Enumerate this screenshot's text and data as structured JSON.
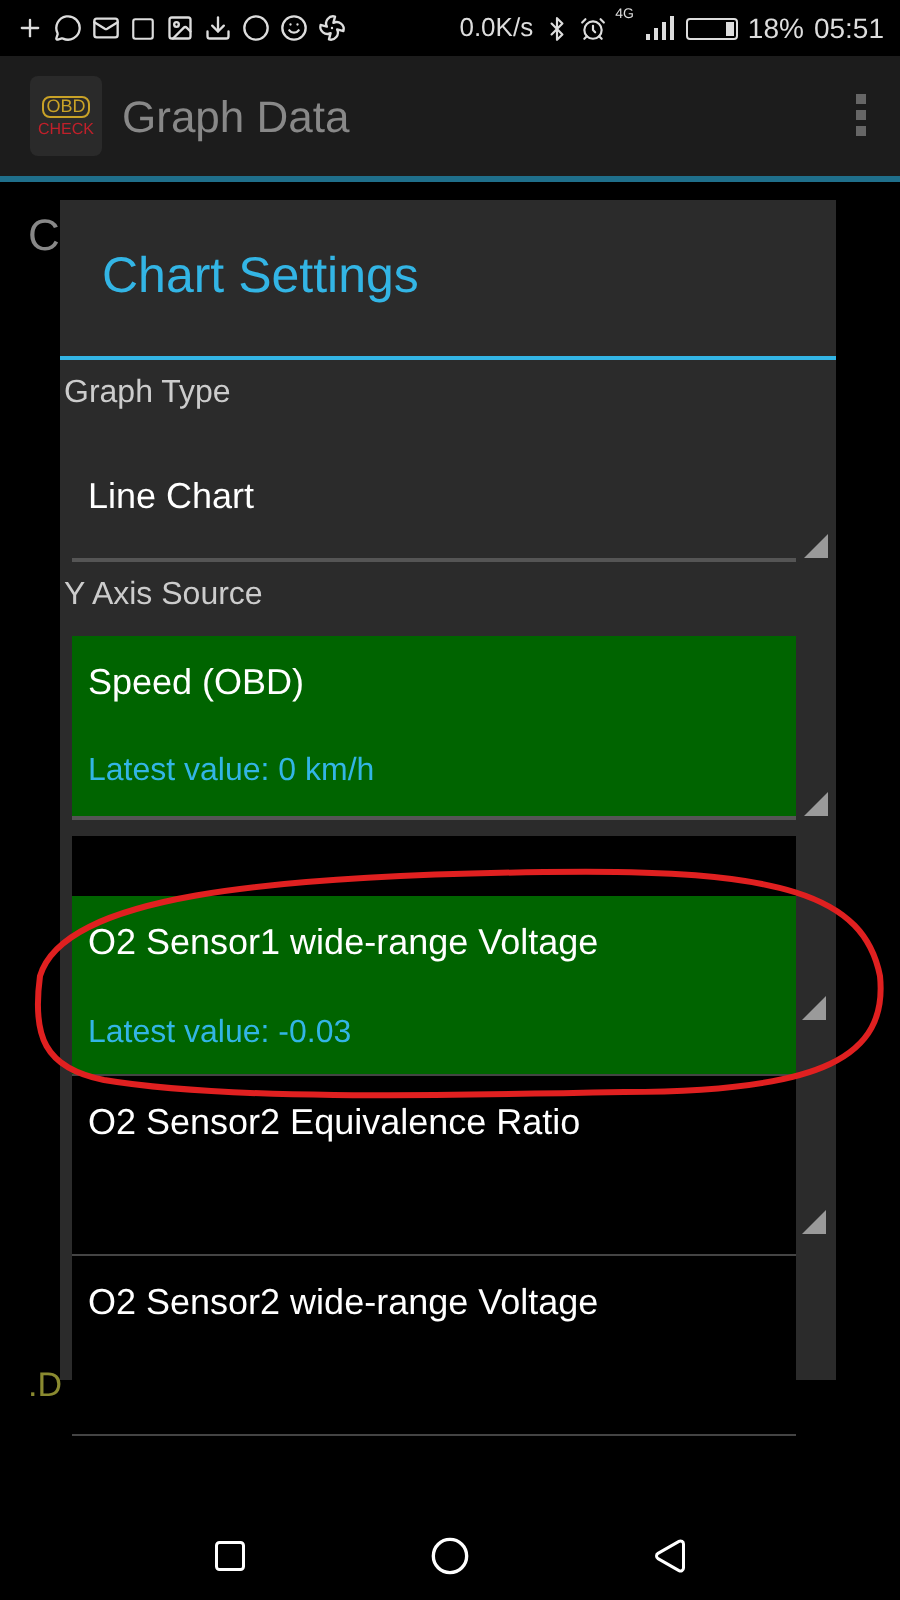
{
  "status_bar": {
    "speed": "0.0K/s",
    "network": "4G",
    "battery": "18%",
    "time": "05:51"
  },
  "app_bar": {
    "logo_top": "OBD",
    "logo_bottom": "CHECK",
    "title": "Graph Data"
  },
  "background": {
    "label_top": "C",
    "label_bottom": ".D"
  },
  "dialog": {
    "title": "Chart Settings",
    "fields": [
      {
        "label": "Graph Type",
        "value": "Line Chart",
        "highlighted": false
      },
      {
        "label": "Y Axis Source",
        "value": "Speed (OBD)",
        "latest": "Latest value: 0 km/h",
        "highlighted": true
      }
    ]
  },
  "dropdown": {
    "items": [
      {
        "name": "O2 Sensor1 wide-range Voltage",
        "latest": "Latest value: -0.03",
        "selected": true
      },
      {
        "name": "O2 Sensor2 Equivalence Ratio",
        "selected": false
      },
      {
        "name": "O2 Sensor2 wide-range Voltage",
        "selected": false
      }
    ]
  }
}
